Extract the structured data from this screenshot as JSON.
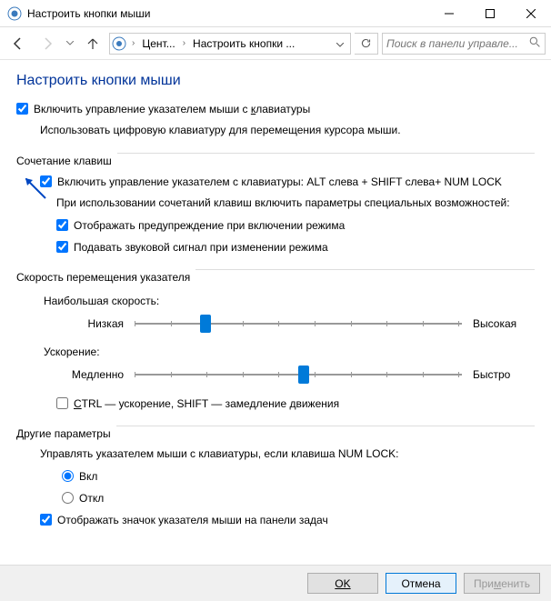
{
  "window": {
    "title": "Настроить кнопки мыши"
  },
  "nav": {
    "crumb1": "Цент...",
    "crumb2": "Настроить кнопки ...",
    "search_placeholder": "Поиск в панели управле..."
  },
  "page": {
    "title": "Настроить кнопки мыши"
  },
  "main_enable": {
    "label": "Включить управление указателем мыши с клавиатуры",
    "checked": true,
    "desc": "Использовать цифровую клавиатуру для перемещения курсора мыши."
  },
  "shortcut": {
    "group_label": "Сочетание клавиш",
    "enable_label": "Включить управление указателем с клавиатуры: ALT слева + SHIFT слева+ NUM LOCK",
    "enable_checked": true,
    "sub_desc": "При использовании сочетаний клавиш включить параметры специальных возможностей:",
    "warn_label": "Отображать предупреждение при включении режима",
    "warn_checked": true,
    "sound_label": "Подавать звуковой сигнал при изменении режима",
    "sound_checked": true
  },
  "speed": {
    "group_label": "Скорость перемещения указателя",
    "top_speed_label": "Наибольшая скорость:",
    "top_speed_left": "Низкая",
    "top_speed_right": "Высокая",
    "top_speed_value": 20,
    "accel_label": "Ускорение:",
    "accel_left": "Медленно",
    "accel_right": "Быстро",
    "accel_value": 50,
    "ctrl_shift_label": "CTRL — ускорение, SHIFT — замедление движения",
    "ctrl_shift_checked": false
  },
  "other": {
    "group_label": "Другие параметры",
    "numlock_question": "Управлять указателем мыши с клавиатуры, если клавиша NUM LOCK:",
    "on_label": "Вкл",
    "off_label": "Откл",
    "numlock_value": "on",
    "tray_label": "Отображать значок указателя мыши на панели задач",
    "tray_checked": true
  },
  "footer": {
    "ok": "OK",
    "cancel": "Отмена",
    "apply": "Применить"
  }
}
